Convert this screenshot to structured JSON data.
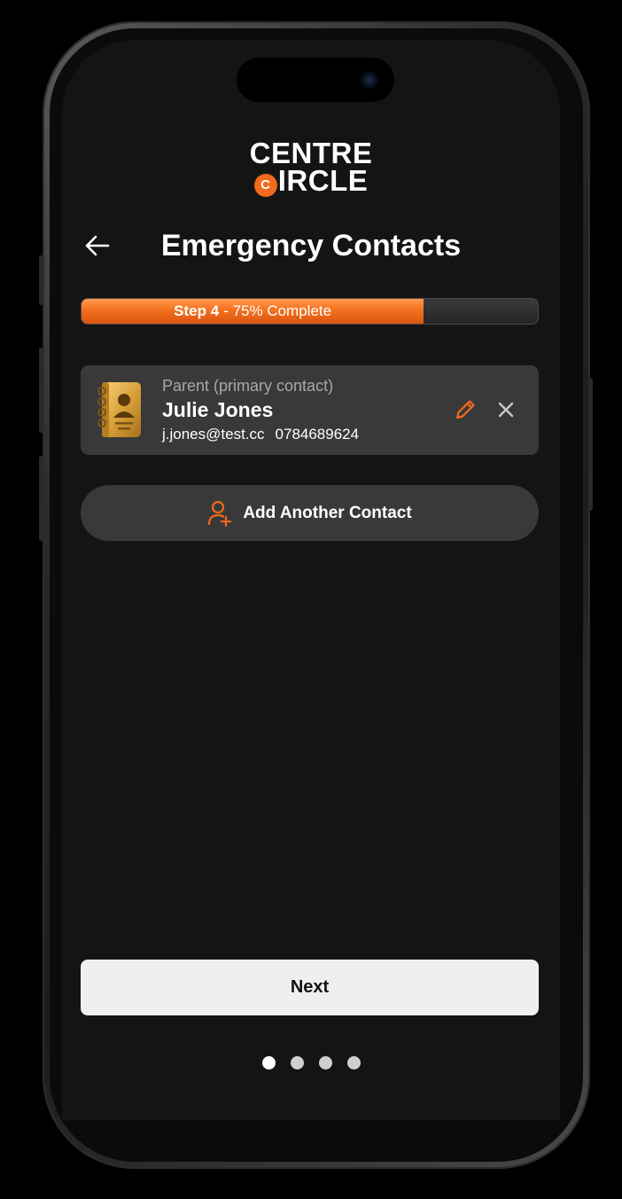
{
  "brand": {
    "line1": "CENTRE",
    "badge_letter": "C",
    "line2_rest": "IRCLE",
    "accent": "#f26a1b"
  },
  "header": {
    "back_icon": "arrow-left-icon",
    "title": "Emergency Contacts"
  },
  "progress": {
    "step_label": "Step 4",
    "separator": " - ",
    "complete_label": "75% Complete",
    "percent": 75
  },
  "contact": {
    "icon": "address-book-icon",
    "role": "Parent (primary contact)",
    "name": "Julie Jones",
    "email": "j.jones@test.cc",
    "phone": "0784689624",
    "edit_icon": "pencil-icon",
    "remove_icon": "close-icon"
  },
  "add_contact": {
    "icon": "add-user-icon",
    "label": "Add Another Contact"
  },
  "next_button": {
    "label": "Next"
  },
  "pagination": {
    "total": 4,
    "active_index": 0
  }
}
